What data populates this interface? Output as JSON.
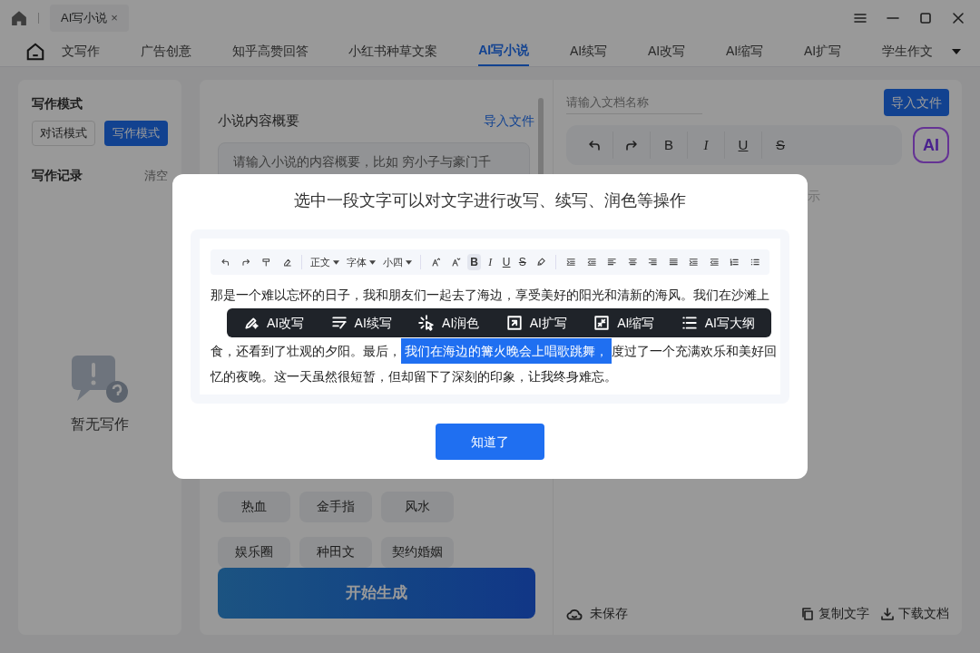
{
  "titlebar": {
    "tab": {
      "label": "AI写小说",
      "close": "×"
    }
  },
  "nav": {
    "tabs": [
      {
        "label": "文写作",
        "selected": false
      },
      {
        "label": "广告创意",
        "selected": false
      },
      {
        "label": "知乎高赞回答",
        "selected": false
      },
      {
        "label": "小红书种草文案",
        "selected": false
      },
      {
        "label": "AI写小说",
        "selected": true
      },
      {
        "label": "AI续写",
        "selected": false
      },
      {
        "label": "AI改写",
        "selected": false
      },
      {
        "label": "AI缩写",
        "selected": false
      },
      {
        "label": "AI扩写",
        "selected": false
      },
      {
        "label": "学生作文",
        "selected": false
      }
    ]
  },
  "sidebar": {
    "mode_title": "写作模式",
    "modes": [
      {
        "label": "对话模式",
        "selected": false
      },
      {
        "label": "写作模式",
        "selected": true
      }
    ],
    "records_title": "写作记录",
    "clear": "清空",
    "empty": "暂无写作"
  },
  "form": {
    "summary_label": "小说内容概要",
    "import_link": "导入文件",
    "summary_placeholder": "请输入小说的内容概要，比如 穷小子与豪门千",
    "tags": [
      "热血",
      "金手指",
      "风水",
      "娱乐圈",
      "种田文",
      "契约婚姻"
    ],
    "generate": "开始生成"
  },
  "editor": {
    "name_placeholder": "请输入文档名称",
    "import_button": "导入文件",
    "toolbar": [
      {
        "kind": "icon"
      },
      {
        "kind": "icon"
      },
      {
        "kind": "text",
        "label": "B"
      },
      {
        "kind": "text",
        "label": "I"
      },
      {
        "kind": "text",
        "label": "U"
      },
      {
        "kind": "text",
        "label": "S"
      }
    ],
    "ai_button": "AI",
    "hint": "示",
    "save_status": "未保存",
    "copy": "复制文字",
    "download": "下载文档"
  },
  "modal": {
    "title": "选中一段文字可以对文字进行改写、续写、润色等操作",
    "toolbar": [
      {
        "kind": "icon"
      },
      {
        "kind": "icon"
      },
      {
        "kind": "icon"
      },
      {
        "kind": "icon"
      },
      {
        "kind": "sep"
      },
      {
        "kind": "select",
        "label": "正文"
      },
      {
        "kind": "select",
        "label": "字体"
      },
      {
        "kind": "select",
        "label": "小四"
      },
      {
        "kind": "sep"
      },
      {
        "kind": "icon"
      },
      {
        "kind": "icon"
      },
      {
        "kind": "text",
        "label": "B",
        "selected": true
      },
      {
        "kind": "text",
        "label": "I",
        "selected": false
      },
      {
        "kind": "text",
        "label": "U",
        "selected": false
      },
      {
        "kind": "text",
        "label": "S",
        "selected": false
      },
      {
        "kind": "icon"
      },
      {
        "kind": "sep"
      },
      {
        "kind": "icon"
      },
      {
        "kind": "icon"
      },
      {
        "kind": "icon"
      },
      {
        "kind": "icon"
      },
      {
        "kind": "icon"
      },
      {
        "kind": "icon"
      },
      {
        "kind": "icon"
      },
      {
        "kind": "icon"
      },
      {
        "kind": "icon"
      },
      {
        "kind": "icon"
      }
    ],
    "lines": [
      {
        "parts": [
          {
            "text": "那是一个难以忘怀的日子，我和朋友们一起去了海边，享受美好的阳光和清新的海风。我们在沙滩上",
            "selected": false
          }
        ]
      },
      {
        "parts": [
          {
            "text": "食，还看到了壮观的夕阳。最后，",
            "selected": false
          },
          {
            "text": "我们在海边的篝火晚会上唱歌跳舞，",
            "selected": true
          },
          {
            "text": "度过了一个充满欢乐和美好回",
            "selected": false
          }
        ]
      },
      {
        "parts": [
          {
            "text": "忆的夜晚。这一天虽然很短暂，但却留下了深刻的印象，让我终身难忘。",
            "selected": false
          }
        ]
      }
    ],
    "actions": [
      "AI改写",
      "AI续写",
      "AI润色",
      "AI扩写",
      "AI缩写",
      "AI写大纲"
    ],
    "ok": "知道了"
  }
}
